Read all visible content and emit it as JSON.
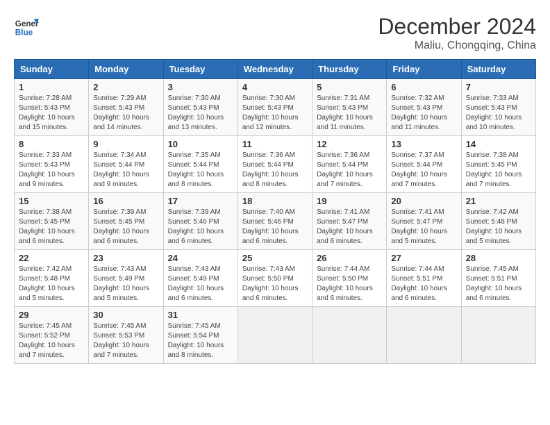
{
  "header": {
    "logo_general": "General",
    "logo_blue": "Blue",
    "month_title": "December 2024",
    "location": "Maliu, Chongqing, China"
  },
  "weekdays": [
    "Sunday",
    "Monday",
    "Tuesday",
    "Wednesday",
    "Thursday",
    "Friday",
    "Saturday"
  ],
  "weeks": [
    [
      {
        "day": "1",
        "info": "Sunrise: 7:28 AM\nSunset: 5:43 PM\nDaylight: 10 hours\nand 15 minutes."
      },
      {
        "day": "2",
        "info": "Sunrise: 7:29 AM\nSunset: 5:43 PM\nDaylight: 10 hours\nand 14 minutes."
      },
      {
        "day": "3",
        "info": "Sunrise: 7:30 AM\nSunset: 5:43 PM\nDaylight: 10 hours\nand 13 minutes."
      },
      {
        "day": "4",
        "info": "Sunrise: 7:30 AM\nSunset: 5:43 PM\nDaylight: 10 hours\nand 12 minutes."
      },
      {
        "day": "5",
        "info": "Sunrise: 7:31 AM\nSunset: 5:43 PM\nDaylight: 10 hours\nand 11 minutes."
      },
      {
        "day": "6",
        "info": "Sunrise: 7:32 AM\nSunset: 5:43 PM\nDaylight: 10 hours\nand 11 minutes."
      },
      {
        "day": "7",
        "info": "Sunrise: 7:33 AM\nSunset: 5:43 PM\nDaylight: 10 hours\nand 10 minutes."
      }
    ],
    [
      {
        "day": "8",
        "info": "Sunrise: 7:33 AM\nSunset: 5:43 PM\nDaylight: 10 hours\nand 9 minutes."
      },
      {
        "day": "9",
        "info": "Sunrise: 7:34 AM\nSunset: 5:44 PM\nDaylight: 10 hours\nand 9 minutes."
      },
      {
        "day": "10",
        "info": "Sunrise: 7:35 AM\nSunset: 5:44 PM\nDaylight: 10 hours\nand 8 minutes."
      },
      {
        "day": "11",
        "info": "Sunrise: 7:36 AM\nSunset: 5:44 PM\nDaylight: 10 hours\nand 8 minutes."
      },
      {
        "day": "12",
        "info": "Sunrise: 7:36 AM\nSunset: 5:44 PM\nDaylight: 10 hours\nand 7 minutes."
      },
      {
        "day": "13",
        "info": "Sunrise: 7:37 AM\nSunset: 5:44 PM\nDaylight: 10 hours\nand 7 minutes."
      },
      {
        "day": "14",
        "info": "Sunrise: 7:38 AM\nSunset: 5:45 PM\nDaylight: 10 hours\nand 7 minutes."
      }
    ],
    [
      {
        "day": "15",
        "info": "Sunrise: 7:38 AM\nSunset: 5:45 PM\nDaylight: 10 hours\nand 6 minutes."
      },
      {
        "day": "16",
        "info": "Sunrise: 7:39 AM\nSunset: 5:45 PM\nDaylight: 10 hours\nand 6 minutes."
      },
      {
        "day": "17",
        "info": "Sunrise: 7:39 AM\nSunset: 5:46 PM\nDaylight: 10 hours\nand 6 minutes."
      },
      {
        "day": "18",
        "info": "Sunrise: 7:40 AM\nSunset: 5:46 PM\nDaylight: 10 hours\nand 6 minutes."
      },
      {
        "day": "19",
        "info": "Sunrise: 7:41 AM\nSunset: 5:47 PM\nDaylight: 10 hours\nand 6 minutes."
      },
      {
        "day": "20",
        "info": "Sunrise: 7:41 AM\nSunset: 5:47 PM\nDaylight: 10 hours\nand 5 minutes."
      },
      {
        "day": "21",
        "info": "Sunrise: 7:42 AM\nSunset: 5:48 PM\nDaylight: 10 hours\nand 5 minutes."
      }
    ],
    [
      {
        "day": "22",
        "info": "Sunrise: 7:42 AM\nSunset: 5:48 PM\nDaylight: 10 hours\nand 5 minutes."
      },
      {
        "day": "23",
        "info": "Sunrise: 7:43 AM\nSunset: 5:49 PM\nDaylight: 10 hours\nand 5 minutes."
      },
      {
        "day": "24",
        "info": "Sunrise: 7:43 AM\nSunset: 5:49 PM\nDaylight: 10 hours\nand 6 minutes."
      },
      {
        "day": "25",
        "info": "Sunrise: 7:43 AM\nSunset: 5:50 PM\nDaylight: 10 hours\nand 6 minutes."
      },
      {
        "day": "26",
        "info": "Sunrise: 7:44 AM\nSunset: 5:50 PM\nDaylight: 10 hours\nand 6 minutes."
      },
      {
        "day": "27",
        "info": "Sunrise: 7:44 AM\nSunset: 5:51 PM\nDaylight: 10 hours\nand 6 minutes."
      },
      {
        "day": "28",
        "info": "Sunrise: 7:45 AM\nSunset: 5:51 PM\nDaylight: 10 hours\nand 6 minutes."
      }
    ],
    [
      {
        "day": "29",
        "info": "Sunrise: 7:45 AM\nSunset: 5:52 PM\nDaylight: 10 hours\nand 7 minutes."
      },
      {
        "day": "30",
        "info": "Sunrise: 7:45 AM\nSunset: 5:53 PM\nDaylight: 10 hours\nand 7 minutes."
      },
      {
        "day": "31",
        "info": "Sunrise: 7:45 AM\nSunset: 5:54 PM\nDaylight: 10 hours\nand 8 minutes."
      },
      {
        "day": "",
        "info": ""
      },
      {
        "day": "",
        "info": ""
      },
      {
        "day": "",
        "info": ""
      },
      {
        "day": "",
        "info": ""
      }
    ]
  ]
}
